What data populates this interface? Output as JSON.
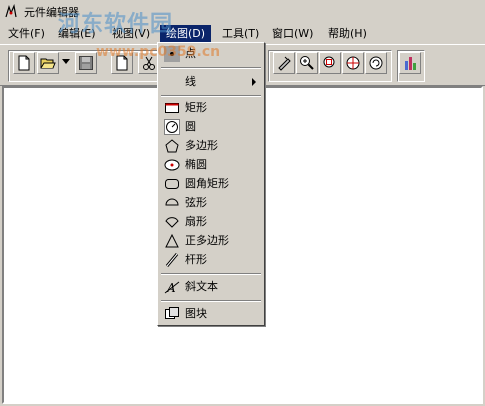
{
  "title": "元件编辑器",
  "watermark": {
    "brand": "河东软件园",
    "url": "www.pc0359.cn"
  },
  "menubar": [
    {
      "label": "文件(F)"
    },
    {
      "label": "编辑(E)"
    },
    {
      "label": "视图(V)"
    },
    {
      "label": "绘图(D)",
      "active": true
    },
    {
      "label": "工具(T)"
    },
    {
      "label": "窗口(W)"
    },
    {
      "label": "帮助(H)"
    }
  ],
  "toolbar": {
    "icons": [
      "new-file-icon",
      "open-folder-icon",
      "save-icon",
      "page-icon",
      "cut-icon",
      "pen-select-icon",
      "zoom-icon",
      "zoom-fit-icon",
      "target-icon",
      "zoom-refresh-icon",
      "bar-chart-icon"
    ]
  },
  "draw_menu": {
    "items": [
      {
        "label": "点",
        "icon": "point-icon"
      },
      {
        "label": "线",
        "icon": "",
        "submenu": true
      },
      {
        "label": "矩形",
        "icon": "rectangle-icon"
      },
      {
        "label": "圆",
        "icon": "circle-icon"
      },
      {
        "label": "多边形",
        "icon": "polygon-icon"
      },
      {
        "label": "椭圆",
        "icon": "ellipse-icon"
      },
      {
        "label": "圆角矩形",
        "icon": "rounded-rectangle-icon"
      },
      {
        "label": "弦形",
        "icon": "chord-icon"
      },
      {
        "label": "扇形",
        "icon": "sector-icon"
      },
      {
        "label": "正多边形",
        "icon": "triangle-icon"
      },
      {
        "label": "杆形",
        "icon": "rod-icon"
      },
      {
        "label": "斜文本",
        "icon": "slanted-text-icon"
      },
      {
        "label": "图块",
        "icon": "block-icon"
      }
    ]
  },
  "colors": {
    "menu_highlight": "#0a246a",
    "face": "#d4d0c8",
    "canvas": "#ffffff"
  }
}
